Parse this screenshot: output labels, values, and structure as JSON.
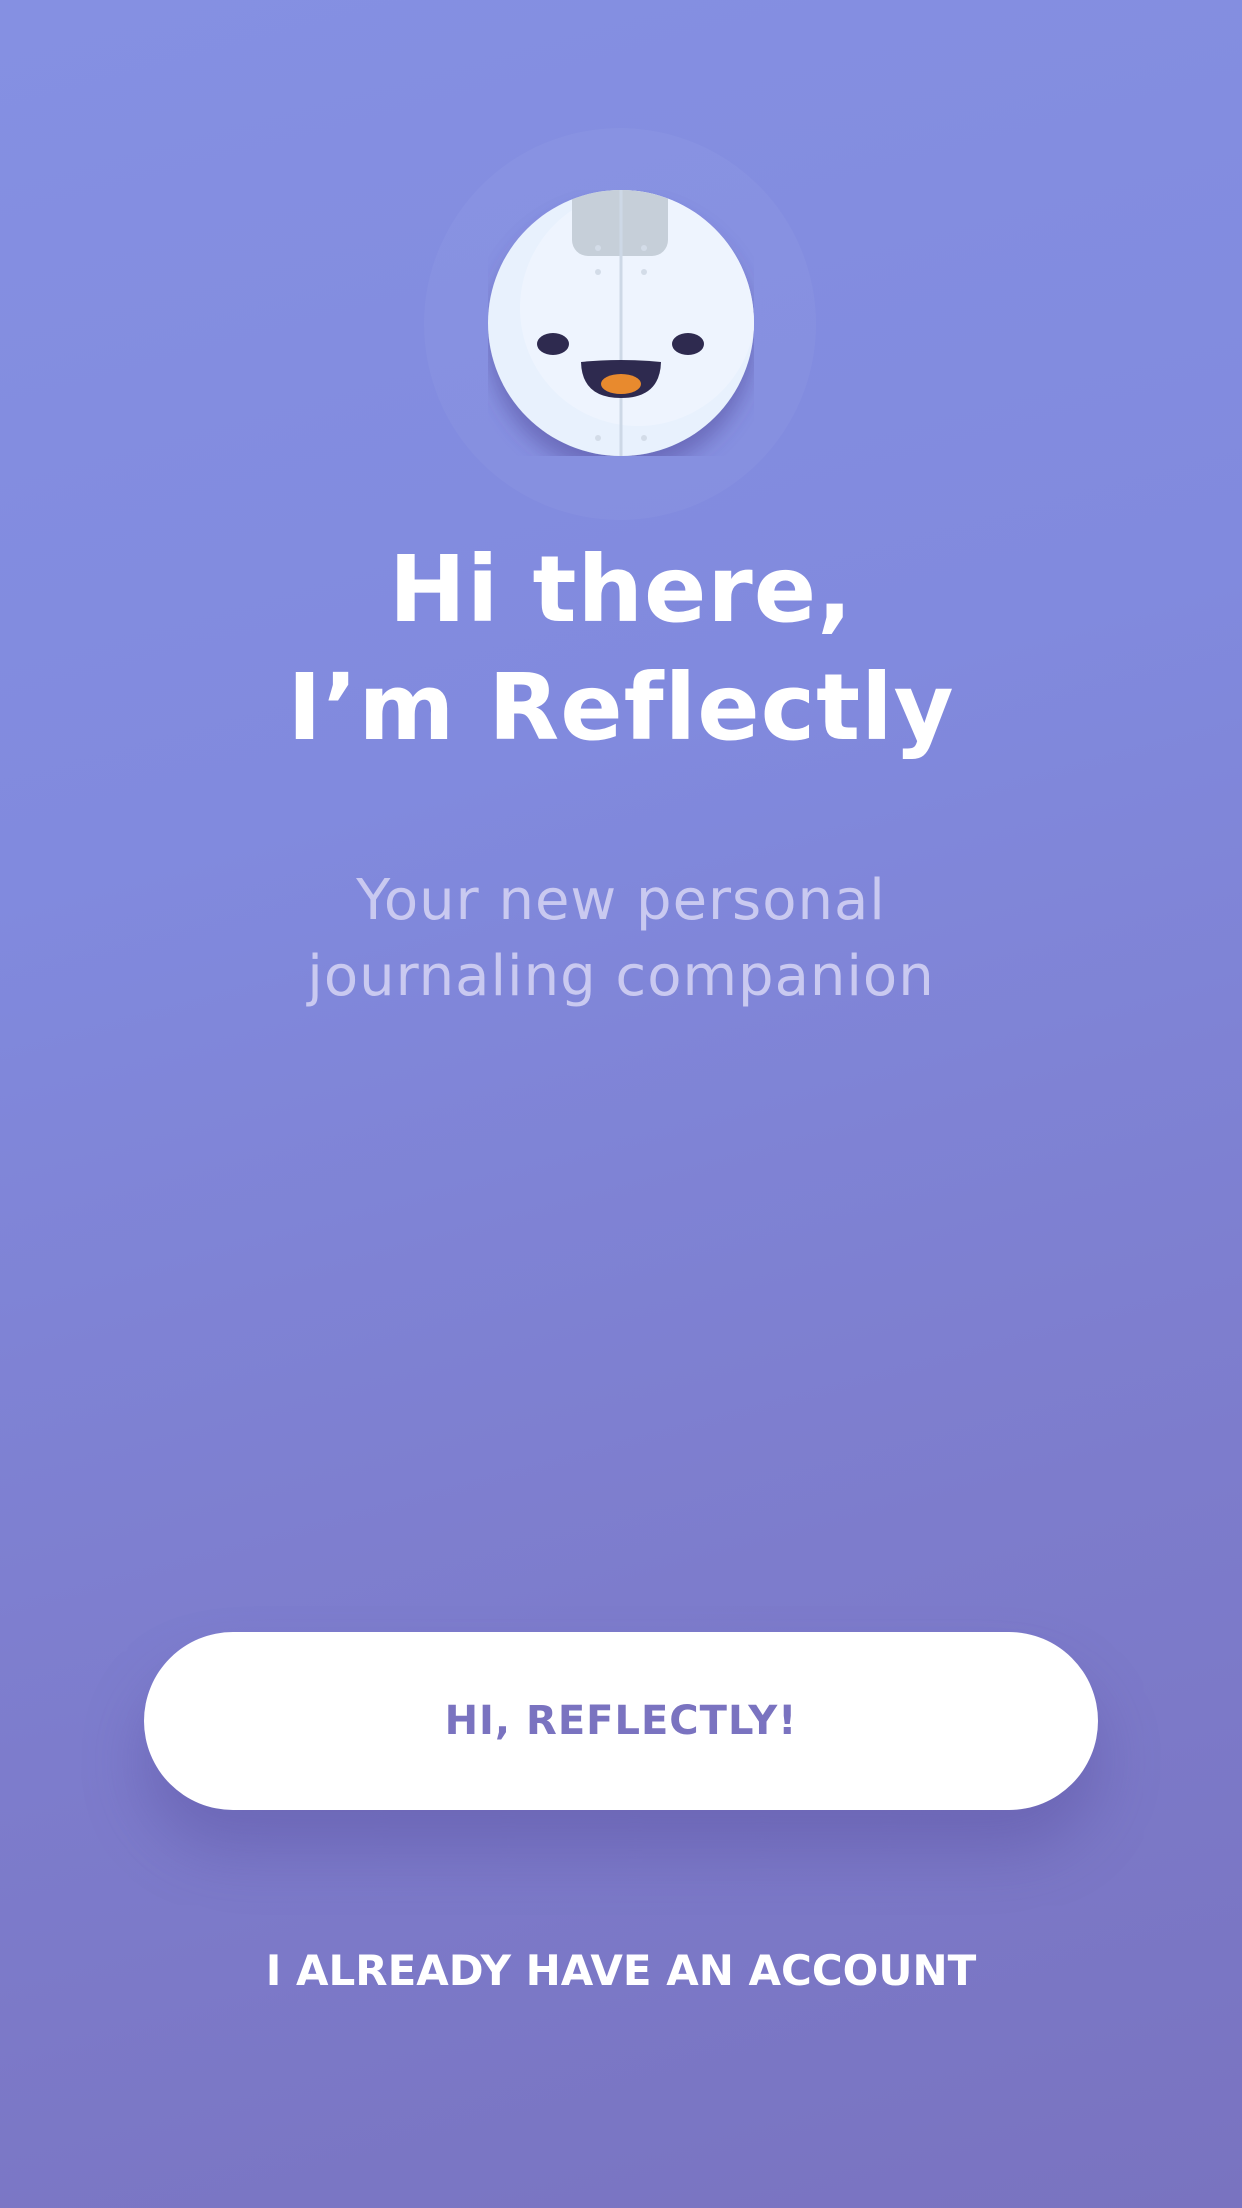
{
  "onboarding": {
    "mascot_icon": "reflectly-mascot-icon",
    "headline_line1": "Hi there,",
    "headline_line2": "I’m Reflectly",
    "subtitle_line1": "Your new personal",
    "subtitle_line2": "journaling companion",
    "primary_button_label": "HI, REFLECTLY!",
    "secondary_link_label": "I ALREADY HAVE AN ACCOUNT"
  },
  "colors": {
    "background_top": "#8590e2",
    "background_bottom": "#7973c0",
    "button_background": "#ffffff",
    "button_text": "#7a73c0",
    "mascot_face": "#e8f0fb",
    "mascot_mouth": "#2e2a4f",
    "mascot_tongue": "#e88a2e"
  }
}
